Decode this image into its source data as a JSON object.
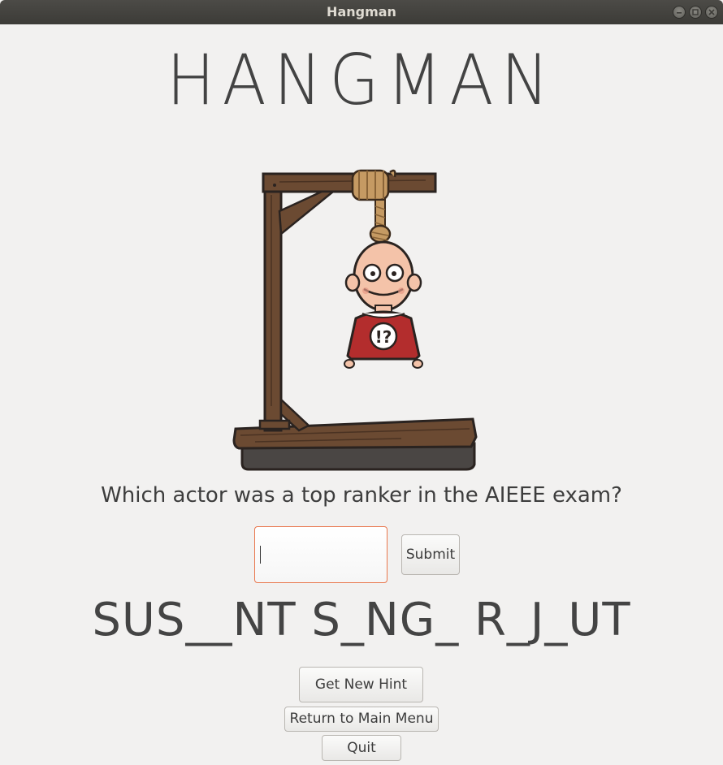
{
  "window": {
    "title": "Hangman"
  },
  "game": {
    "title": "HANGMAN",
    "question": "Which actor was a top ranker in the AIEEE exam?",
    "puzzle": "SUS__NT S_NG_ R_J_UT",
    "answer_input": {
      "value": "",
      "placeholder": ""
    },
    "shirt_symbol": "!?"
  },
  "buttons": {
    "submit": "Submit",
    "hint": "Get New Hint",
    "main_menu": "Return to Main Menu",
    "quit": "Quit"
  },
  "icons": {
    "minimize": "minimize-icon",
    "maximize": "maximize-icon",
    "close": "close-icon"
  },
  "colors": {
    "input_focus_border": "#e9774d",
    "shirt": "#b32d2d",
    "wood": "#6b4a32"
  }
}
